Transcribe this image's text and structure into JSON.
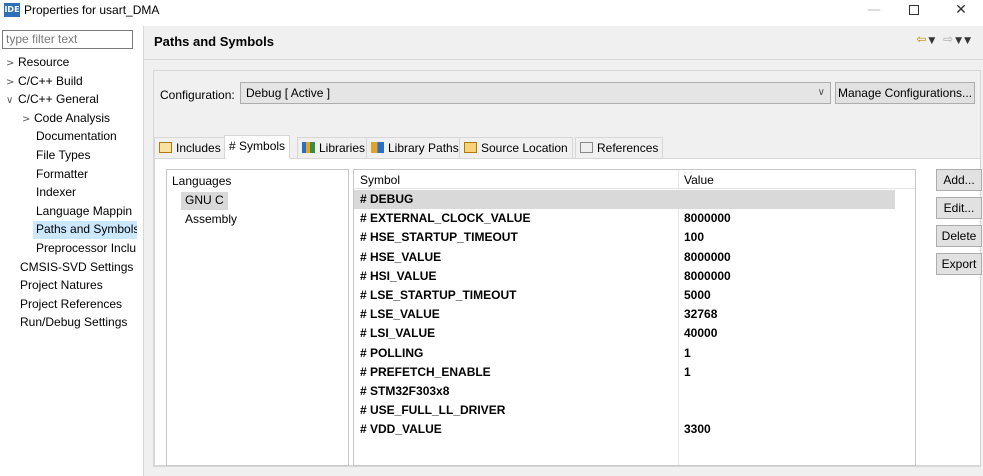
{
  "window": {
    "icon_text": "IDE",
    "title": "Properties for usart_DMA",
    "min": "—",
    "close": "✕"
  },
  "filter": {
    "placeholder": "type filter text"
  },
  "tree": [
    {
      "label": "Resource",
      "chev": ">",
      "indent": 0
    },
    {
      "label": "C/C++ Build",
      "chev": ">",
      "indent": 0
    },
    {
      "label": "C/C++ General",
      "chev": "∨",
      "indent": 0
    },
    {
      "label": "Code Analysis",
      "chev": ">",
      "indent": 1
    },
    {
      "label": "Documentation",
      "chev": "",
      "indent": 2
    },
    {
      "label": "File Types",
      "chev": "",
      "indent": 2
    },
    {
      "label": "Formatter",
      "chev": "",
      "indent": 2
    },
    {
      "label": "Indexer",
      "chev": "",
      "indent": 2
    },
    {
      "label": "Language Mappin",
      "chev": "",
      "indent": 2
    },
    {
      "label": "Paths and Symbols",
      "chev": "",
      "indent": 2,
      "selected": true
    },
    {
      "label": "Preprocessor Inclu",
      "chev": "",
      "indent": 2
    },
    {
      "label": "CMSIS-SVD Settings",
      "chev": "",
      "indent": 3
    },
    {
      "label": "Project Natures",
      "chev": "",
      "indent": 3
    },
    {
      "label": "Project References",
      "chev": "",
      "indent": 3
    },
    {
      "label": "Run/Debug Settings",
      "chev": "",
      "indent": 3
    }
  ],
  "page": {
    "title": "Paths and Symbols",
    "nav": {
      "back": "⇦",
      "fwd": "⇨",
      "dd": "▼"
    }
  },
  "config": {
    "label": "Configuration:",
    "value": "Debug  [ Active ]",
    "arrow": "∨",
    "manage": "Manage Configurations..."
  },
  "tabs": [
    {
      "label": "Includes",
      "icon": "includes-icon"
    },
    {
      "label": "Symbols",
      "icon": "symbols-icon",
      "active": true,
      "glyph": "#"
    },
    {
      "label": "Libraries",
      "icon": "libraries-icon"
    },
    {
      "label": "Library Paths",
      "icon": "library-paths-icon"
    },
    {
      "label": "Source Location",
      "icon": "source-location-icon"
    },
    {
      "label": "References",
      "icon": "references-icon"
    }
  ],
  "languages": {
    "header": "Languages",
    "items": [
      {
        "label": "GNU C",
        "selected": true
      },
      {
        "label": "Assembly"
      }
    ]
  },
  "symbols": {
    "col_symbol": "Symbol",
    "col_value": "Value",
    "rows": [
      {
        "symbol": "# DEBUG",
        "value": "",
        "selected": true
      },
      {
        "symbol": "# EXTERNAL_CLOCK_VALUE",
        "value": "8000000"
      },
      {
        "symbol": "# HSE_STARTUP_TIMEOUT",
        "value": "100"
      },
      {
        "symbol": "# HSE_VALUE",
        "value": "8000000"
      },
      {
        "symbol": "# HSI_VALUE",
        "value": "8000000"
      },
      {
        "symbol": "# LSE_STARTUP_TIMEOUT",
        "value": "5000"
      },
      {
        "symbol": "# LSE_VALUE",
        "value": "32768"
      },
      {
        "symbol": "# LSI_VALUE",
        "value": "40000"
      },
      {
        "symbol": "# POLLING",
        "value": "1"
      },
      {
        "symbol": "# PREFETCH_ENABLE",
        "value": "1"
      },
      {
        "symbol": "# STM32F303x8",
        "value": ""
      },
      {
        "symbol": "# USE_FULL_LL_DRIVER",
        "value": ""
      },
      {
        "symbol": "# VDD_VALUE",
        "value": "3300"
      }
    ]
  },
  "buttons": {
    "add": "Add...",
    "edit": "Edit...",
    "delete": "Delete",
    "export": "Export"
  }
}
